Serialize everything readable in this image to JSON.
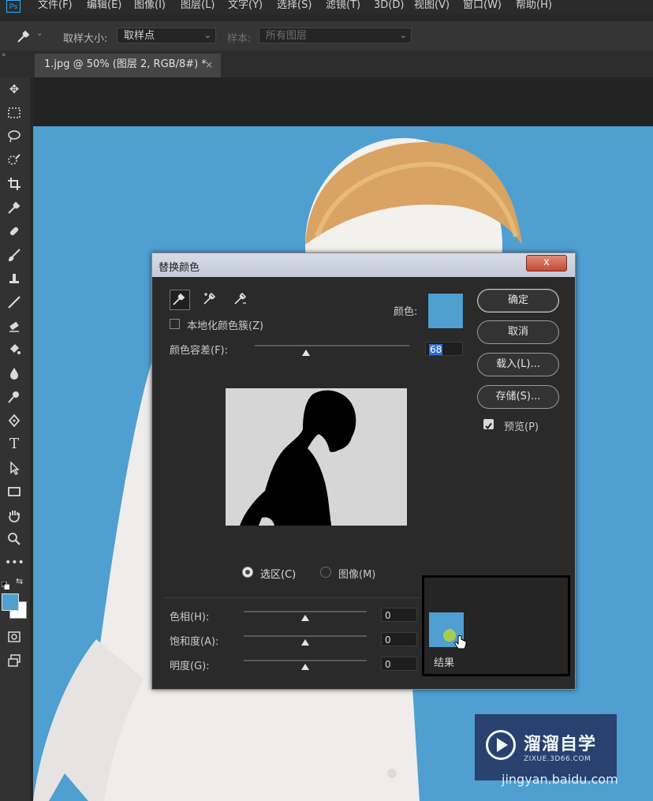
{
  "menu": [
    "文件(F)",
    "编辑(E)",
    "图像(I)",
    "图层(L)",
    "文字(Y)",
    "选择(S)",
    "滤镜(T)",
    "3D(D)",
    "视图(V)",
    "窗口(W)",
    "帮助(H)"
  ],
  "app_logo": "Ps",
  "options": {
    "sample_size_label": "取样大小:",
    "sample_size_value": "取样点",
    "sample_label": "样本:",
    "sample_value": "所有图层"
  },
  "tab": {
    "title": "1.jpg @ 50% (图层 2, RGB/8#) *",
    "close": "×"
  },
  "dialog": {
    "title": "替换颜色",
    "close": "x",
    "localized_label": "本地化颜色簇(Z)",
    "color_label": "颜色:",
    "tolerance_label": "颜色容差(F):",
    "tolerance_value": "68",
    "tolerance_fraction": 0.33,
    "buttons": {
      "ok": "确定",
      "cancel": "取消",
      "load": "载入(L)...",
      "save": "存储(S)..."
    },
    "preview_label": "预览(P)",
    "preview_checked": true,
    "radio_selection": "选区(C)",
    "radio_image": "图像(M)",
    "hue_label": "色相(H):",
    "hue_value": "0",
    "saturation_label": "饱和度(A):",
    "saturation_value": "0",
    "lightness_label": "明度(G):",
    "lightness_value": "0",
    "result_label": "结果"
  },
  "watermark": {
    "brand": "溜溜自学",
    "domain": "ZIXUE.3D66.COM",
    "url": "jingyan.baidu.com"
  },
  "colors": {
    "accent_blue": "#4f9fd0",
    "dialog_bg": "#2a2a2a",
    "ui_dark": "#323232"
  }
}
